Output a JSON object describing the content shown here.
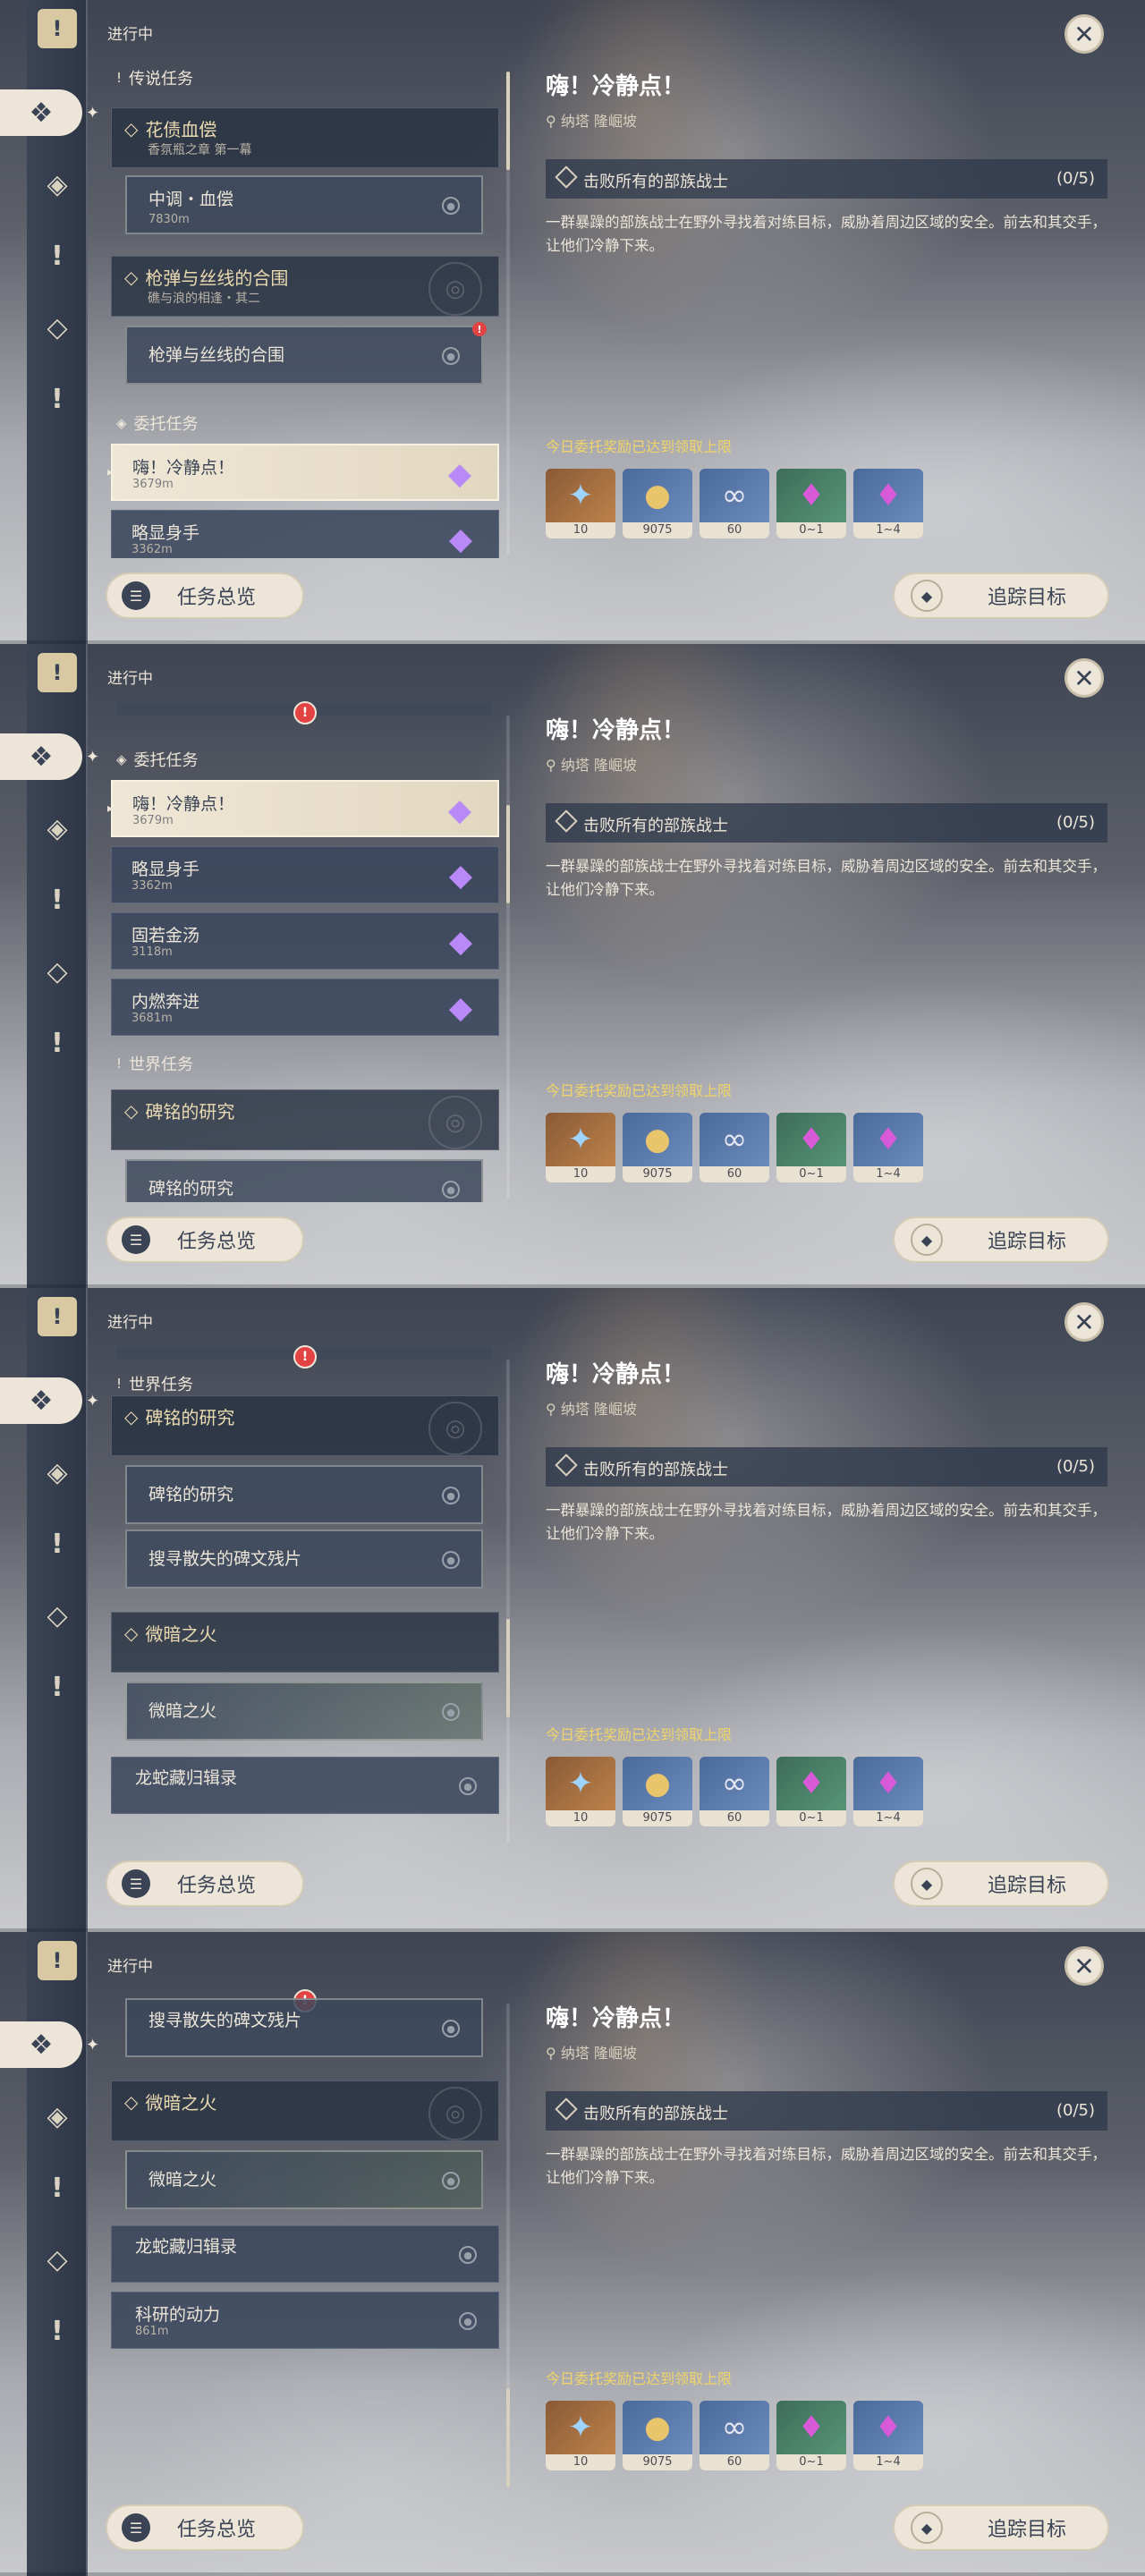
{
  "ui": {
    "status_title": "进行中",
    "close_glyph": "✕",
    "overview_label": "任务总览",
    "track_label": "追踪目标",
    "title": "嗨！冷静点！",
    "location": "纳塔 隆崛坡",
    "objective": "击败所有的部族战士",
    "objective_count": "(0/5)",
    "description": "一群暴躁的部族战士在野外寻找着对练目标，威胁着周边区域的安全。前去和其交手，让他们冷静下来。",
    "limit_notice": "今日委托奖励已达到领取上限",
    "rewards": [
      {
        "icon": "primogem-icon",
        "qty": "10"
      },
      {
        "icon": "mora-icon",
        "qty": "9075"
      },
      {
        "icon": "adventure-exp-icon",
        "qty": "60"
      },
      {
        "icon": "crystal-ore-icon",
        "qty": "0~1"
      },
      {
        "icon": "crystal-ore-icon",
        "qty": "1~4"
      }
    ]
  },
  "rail": {
    "icons": [
      "archon-quest-banner-icon",
      "commission-icon",
      "story-quest-icon",
      "world-quest-icon",
      "event-quest-icon",
      "request-icon"
    ]
  },
  "quests": {
    "legend_header": "传说任务",
    "legend_1_title": "花债血偿",
    "legend_1_sub": "香氛瓶之章 第一幕",
    "legend_1_step": "中调・血偿",
    "legend_1_step_dist": "7830m",
    "legend_2_title": "枪弹与丝线的合围",
    "legend_2_sub": "礁与浪的相逢・其二",
    "legend_2_step": "枪弹与丝线的合围",
    "comm_header": "委托任务",
    "comm_1": "嗨！冷静点！",
    "comm_1_dist": "3679m",
    "comm_2": "略显身手",
    "comm_2_dist": "3362m",
    "comm_3": "固若金汤",
    "comm_3_dist": "3118m",
    "comm_4": "内燃奔进",
    "comm_4_dist": "3681m",
    "world_header": "世界任务",
    "world_1_title": "碑铭的研究",
    "world_1_step": "碑铭的研究",
    "world_1_step2": "搜寻散失的碑文残片",
    "world_2_title": "微暗之火",
    "world_2_step": "微暗之火",
    "world_3": "龙蛇藏归辑录",
    "world_4": "科研的动力",
    "world_4_dist": "861m"
  }
}
